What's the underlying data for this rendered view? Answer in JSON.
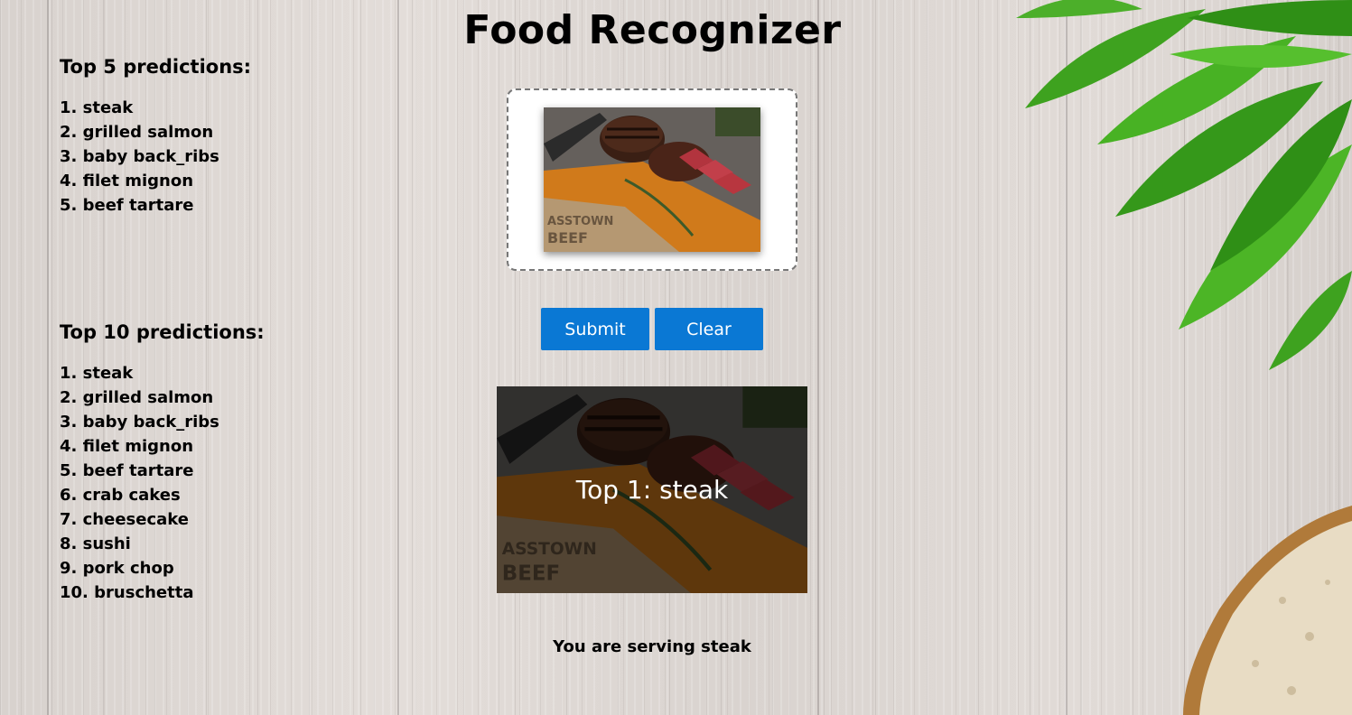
{
  "app": {
    "title": "Food Recognizer"
  },
  "top5": {
    "heading": "Top 5 predictions:",
    "items": [
      "1. steak",
      "2. grilled salmon",
      "3. baby back_ribs",
      "4. filet mignon",
      "5. beef tartare"
    ]
  },
  "top10": {
    "heading": "Top 10 predictions:",
    "items": [
      "1. steak",
      "2. grilled salmon",
      "3. baby back_ribs",
      "4. filet mignon",
      "5. beef tartare",
      "6. crab cakes",
      "7. cheesecake",
      "8. sushi",
      "9. pork chop",
      "10. bruschetta"
    ]
  },
  "buttons": {
    "submit": "Submit",
    "clear": "Clear"
  },
  "result": {
    "caption": "Top 1: steak",
    "serving": "You are serving steak"
  },
  "image_text": {
    "board_stamp": "ASSTOWN BEEF"
  },
  "colors": {
    "button": "#0a78d4",
    "background": "#dcd6d1",
    "leaf": "#3faa1f"
  }
}
